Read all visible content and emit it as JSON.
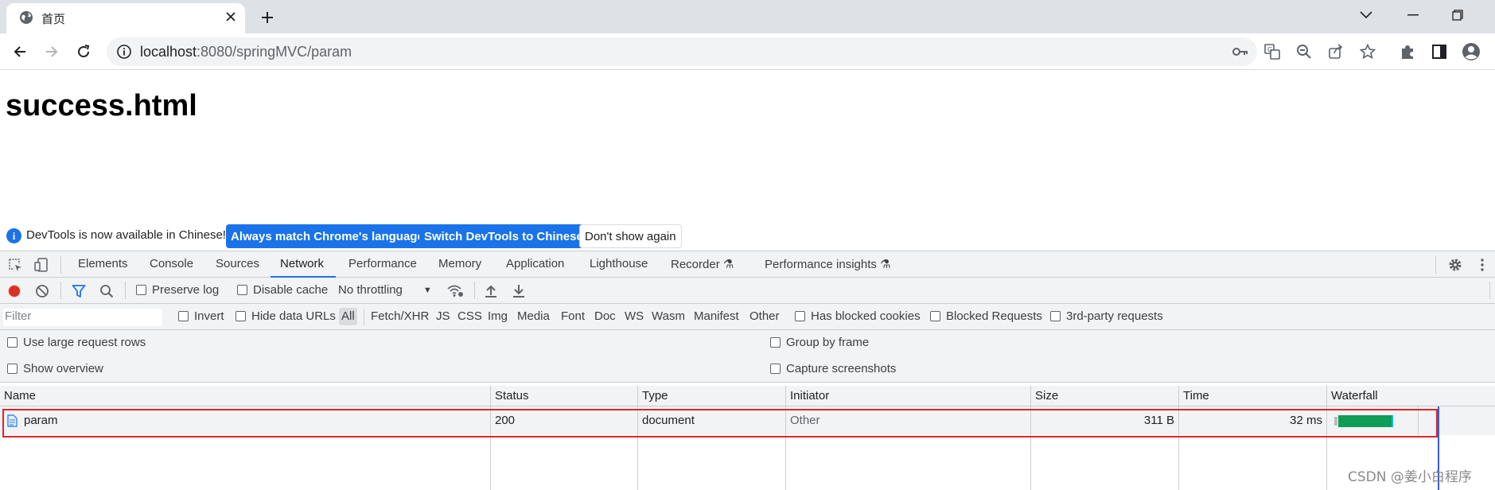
{
  "browser": {
    "tab_title": "首页",
    "url_host": "localhost",
    "url_rest": ":8080/springMVC/param"
  },
  "page": {
    "heading": "success.html"
  },
  "infobar": {
    "message": "DevTools is now available in Chinese!",
    "match_language_label": "Always match Chrome's language",
    "switch_label": "Switch DevTools to Chinese",
    "dismiss_label": "Don't show again"
  },
  "devtools": {
    "tabs": [
      {
        "label": "Elements"
      },
      {
        "label": "Console"
      },
      {
        "label": "Sources"
      },
      {
        "label": "Network"
      },
      {
        "label": "Performance"
      },
      {
        "label": "Memory"
      },
      {
        "label": "Application"
      },
      {
        "label": "Lighthouse"
      },
      {
        "label": "Recorder"
      },
      {
        "label": "Performance insights"
      }
    ],
    "active_tab": "Network",
    "network": {
      "preserve_log": "Preserve log",
      "disable_cache": "Disable cache",
      "throttling": "No throttling",
      "filter_placeholder": "Filter",
      "invert": "Invert",
      "hide_data_urls": "Hide data URLs",
      "type_filters": [
        "All",
        "Fetch/XHR",
        "JS",
        "CSS",
        "Img",
        "Media",
        "Font",
        "Doc",
        "WS",
        "Wasm",
        "Manifest",
        "Other"
      ],
      "has_blocked_cookies": "Has blocked cookies",
      "blocked_requests": "Blocked Requests",
      "third_party_requests": "3rd-party requests",
      "large_rows": "Use large request rows",
      "show_overview": "Show overview",
      "group_by_frame": "Group by frame",
      "capture_screenshots": "Capture screenshots",
      "columns": [
        "Name",
        "Status",
        "Type",
        "Initiator",
        "Size",
        "Time",
        "Waterfall"
      ],
      "requests": [
        {
          "name": "param",
          "status": "200",
          "type": "document",
          "initiator": "Other",
          "size": "311 B",
          "time": "32 ms"
        }
      ]
    }
  },
  "colors": {
    "accent": "#1a73e8",
    "highlight_border": "#e0242c",
    "waterfall_bar": "#0f9d58",
    "record_button": "#d93025"
  },
  "watermark": "CSDN @姜小白程序"
}
